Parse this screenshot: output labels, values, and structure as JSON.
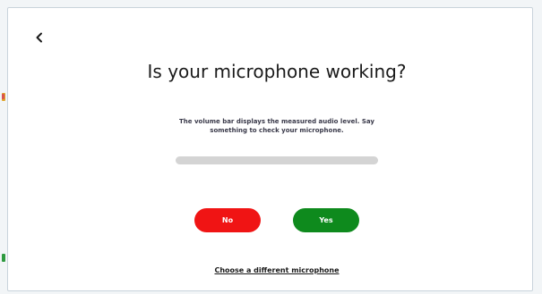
{
  "dialog": {
    "back_icon": "chevron-left-icon",
    "title": "Is your microphone working?",
    "description": "The volume bar displays the measured audio level. Say something to check your microphone.",
    "volume_level": 0,
    "no_label": "No",
    "yes_label": "Yes",
    "change_mic_label": "Choose a different microphone"
  },
  "colors": {
    "no_button": "#f01414",
    "yes_button": "#0e8a1d",
    "volume_track": "#d4d4d4"
  }
}
